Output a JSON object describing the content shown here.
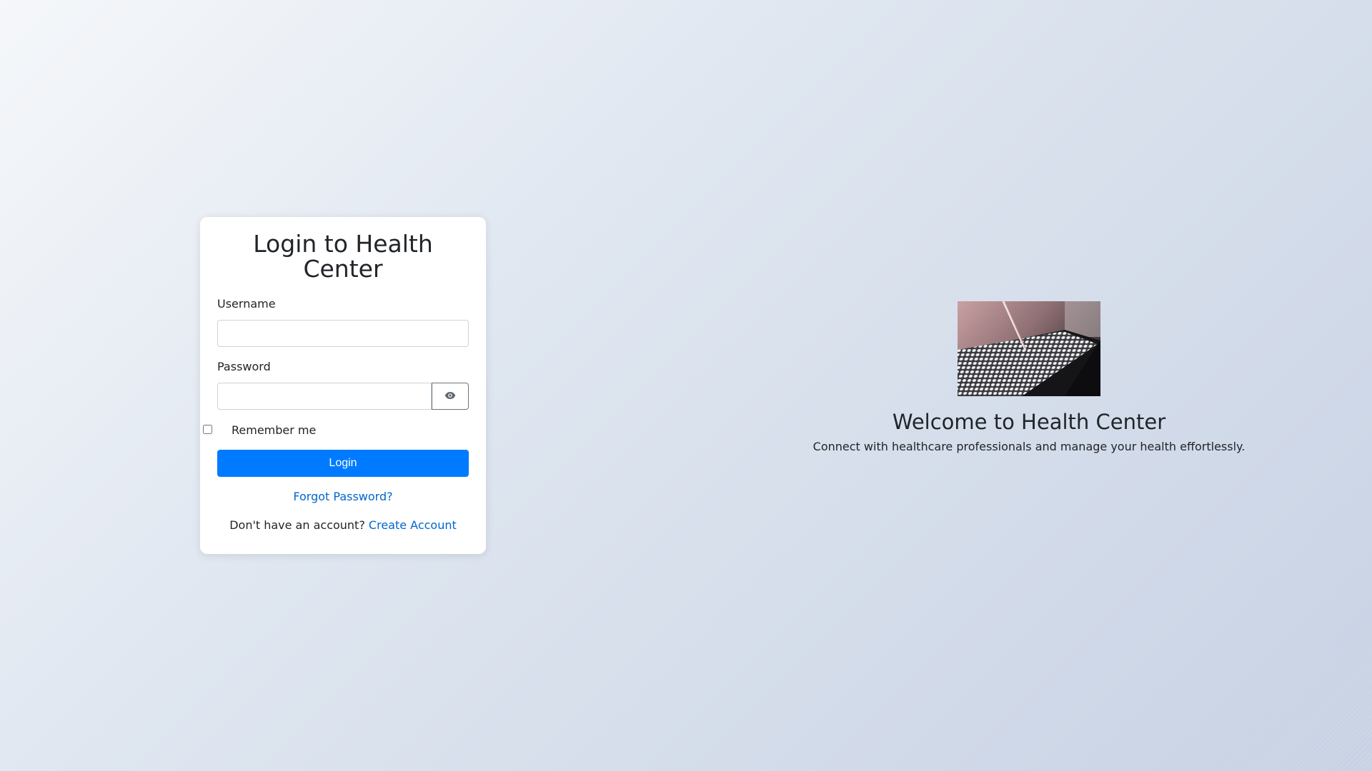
{
  "login": {
    "title": "Login to Health Center",
    "username_label": "Username",
    "username_value": "",
    "password_label": "Password",
    "password_value": "",
    "password_toggle_icon": "eye-icon",
    "remember_label": "Remember me",
    "remember_checked": false,
    "submit_label": "Login",
    "forgot_label": "Forgot Password?",
    "signup_prompt": "Don't have an account?",
    "signup_link": "Create Account"
  },
  "welcome": {
    "image": "lab-pipette-well-plate-photo",
    "title": "Welcome to Health Center",
    "subtitle": "Connect with healthcare professionals and manage your health effortlessly."
  },
  "colors": {
    "primary": "#007bff",
    "link": "#0066cc",
    "text": "#212529"
  }
}
